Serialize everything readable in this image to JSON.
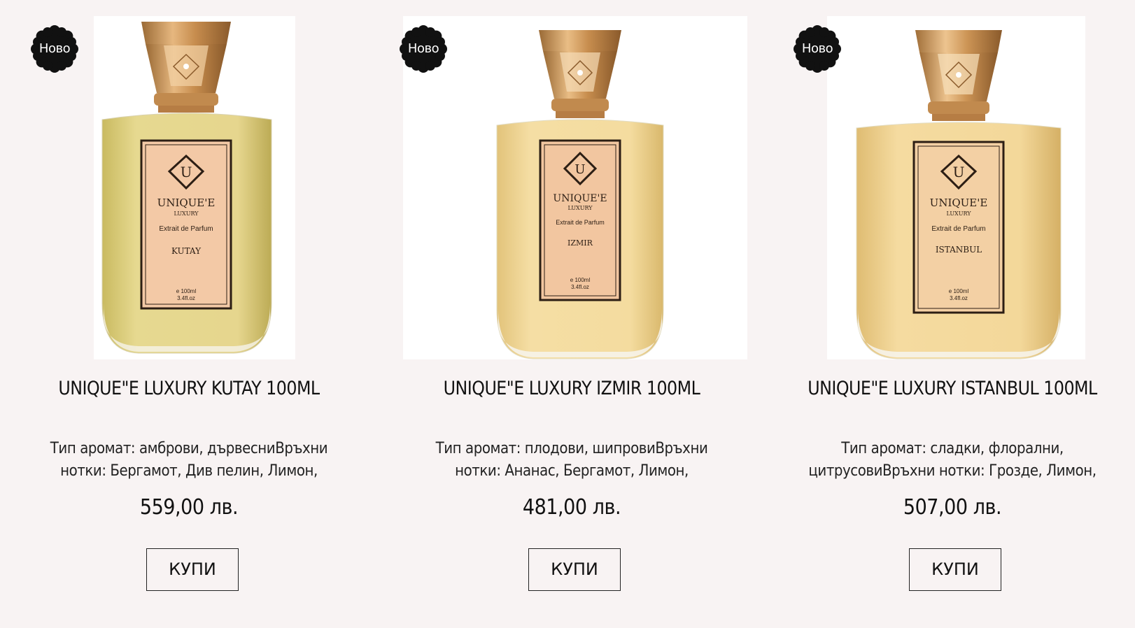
{
  "products": [
    {
      "badge": "Ново",
      "title": "UNIQUE\"E LUXURY KUTAY 100ML",
      "description_line1": "Тип аромат: амброви, дървесниВръхни",
      "description_line2": "нотки: Бергамот, Див пелин, Лимон,",
      "price": "559,00 лв.",
      "buy_label": "КУПИ",
      "label": {
        "brand": "UNIQUE'E",
        "sub": "LUXURY",
        "type": "Extrait de Parfum",
        "name": "KUTAY",
        "volume": "e 100ml",
        "oz": "3.4fl.oz"
      },
      "liquid_color": "#e3d48a"
    },
    {
      "badge": "Ново",
      "title": "UNIQUE\"E LUXURY IZMIR 100ML",
      "description_line1": "Тип аромат: плодови, шипровиВръхни",
      "description_line2": "нотки: Ананас, Бергамот, Лимон,",
      "price": "481,00 лв.",
      "buy_label": "КУПИ",
      "label": {
        "brand": "UNIQUE'E",
        "sub": "LUXURY",
        "type": "Extrait de Parfum",
        "name": "IZMIR",
        "volume": "e 100ml",
        "oz": "3.4fl.oz"
      },
      "liquid_color": "#f0d79a"
    },
    {
      "badge": "Ново",
      "title": "UNIQUE\"E LUXURY ISTANBUL 100ML",
      "description_line1": "Тип аромат: сладки, флорални,",
      "description_line2": "цитрусовиВръхни нотки: Грозде, Лимон,",
      "price": "507,00 лв.",
      "buy_label": "КУПИ",
      "label": {
        "brand": "UNIQUE'E",
        "sub": "LUXURY",
        "type": "Extrait de Parfum",
        "name": "ISTANBUL",
        "volume": "e 100ml",
        "oz": "3.4fl.oz"
      },
      "liquid_color": "#efd391"
    }
  ],
  "colors": {
    "page_background": "#f8f3f3",
    "badge_background": "#111111",
    "cap_gold": "#c9904f",
    "label_peach": "#f3c9a6"
  }
}
